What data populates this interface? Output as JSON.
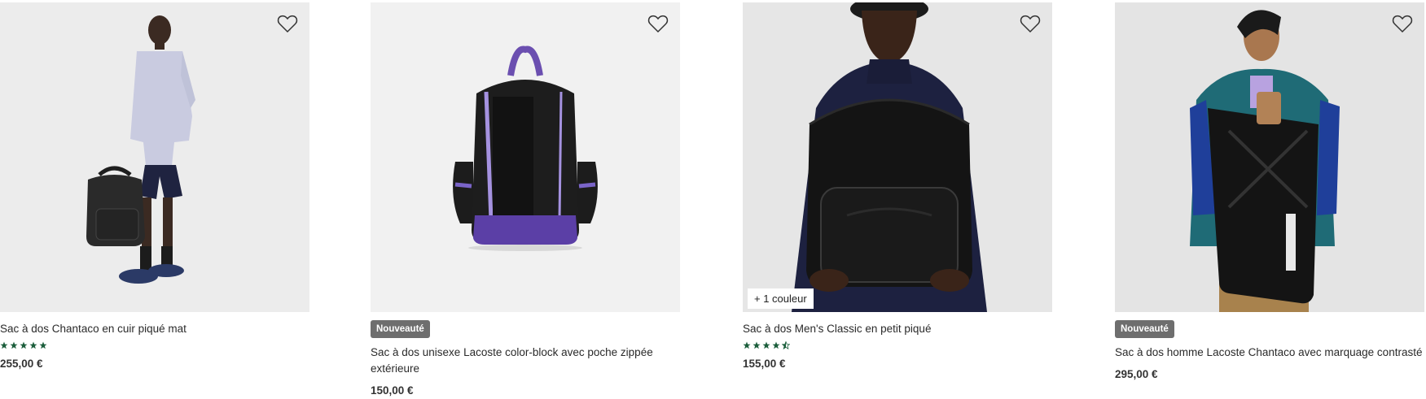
{
  "products": [
    {
      "title": "Sac à dos Chantaco en cuir piqué mat",
      "price": "255,00 €",
      "rating": 5,
      "badge": "",
      "color_tag": ""
    },
    {
      "title": "Sac à dos unisexe Lacoste color-block avec poche zippée extérieure",
      "price": "150,00 €",
      "badge": "Nouveauté",
      "color_tag": ""
    },
    {
      "title": "Sac à dos Men's Classic en petit piqué",
      "price": "155,00 €",
      "rating": 4.5,
      "badge": "",
      "color_tag": "+ 1 couleur"
    },
    {
      "title": "Sac à dos homme Lacoste Chantaco avec marquage contrasté",
      "price": "295,00 €",
      "badge": "Nouveauté",
      "color_tag": ""
    }
  ],
  "icons": {
    "wishlist": "heart-outline-icon",
    "rating": "star-icon"
  },
  "colors": {
    "star": "#1b5e3b",
    "badge_bg": "#6e6e6e",
    "price": "#333333"
  }
}
